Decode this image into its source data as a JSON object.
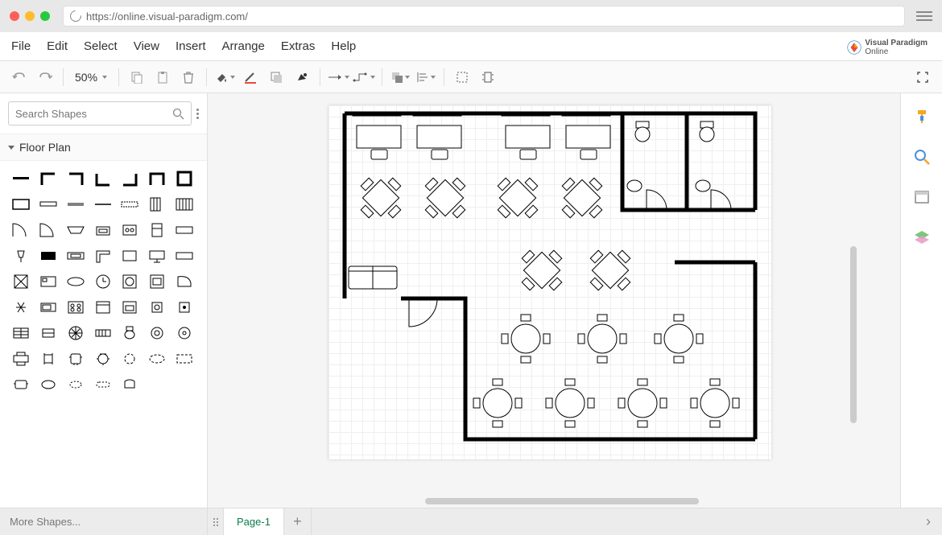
{
  "url": "https://online.visual-paradigm.com/",
  "brand": {
    "line1": "Visual Paradigm",
    "line2": "Online"
  },
  "menu": {
    "file": "File",
    "edit": "Edit",
    "select": "Select",
    "view": "View",
    "insert": "Insert",
    "arrange": "Arrange",
    "extras": "Extras",
    "help": "Help"
  },
  "toolbar": {
    "zoom": "50%"
  },
  "sidebar": {
    "search_placeholder": "Search Shapes",
    "category": "Floor Plan",
    "more_shapes": "More Shapes..."
  },
  "tabs": {
    "page1": "Page-1"
  },
  "right_rail": {
    "format_icon": "format-painter-icon",
    "search_icon": "search-icon",
    "outline_icon": "outline-icon",
    "layers_icon": "layers-icon"
  }
}
